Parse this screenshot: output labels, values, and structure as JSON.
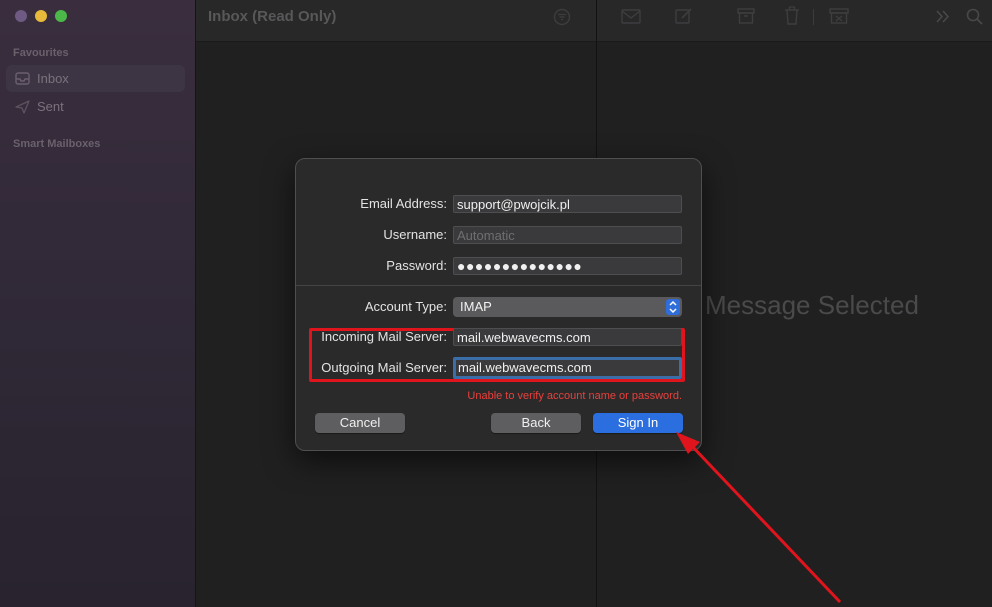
{
  "sidebar": {
    "favourites_title": "Favourites",
    "items": [
      {
        "label": "Inbox",
        "icon": "inbox-icon",
        "active": true
      },
      {
        "label": "Sent",
        "icon": "paper-plane-icon",
        "active": false
      }
    ],
    "smart_mailboxes_title": "Smart Mailboxes"
  },
  "message_list": {
    "title": "Inbox (Read Only)",
    "filter_icon": "filter-icon"
  },
  "viewer": {
    "toolbar_icons": [
      "envelope-icon",
      "compose-icon",
      "archive-icon",
      "trash-icon",
      "junk-icon",
      "chevron-double-right-icon",
      "search-icon"
    ],
    "empty_text": "Message Selected"
  },
  "dialog": {
    "email_label": "Email Address:",
    "email_value": "support@pwojcik.pl",
    "username_label": "Username:",
    "username_placeholder": "Automatic",
    "password_label": "Password:",
    "password_value": "●●●●●●●●●●●●●●",
    "account_type_label": "Account Type:",
    "account_type_value": "IMAP",
    "incoming_label": "Incoming Mail Server:",
    "incoming_value": "mail.webwavecms.com",
    "outgoing_label": "Outgoing Mail Server:",
    "outgoing_value": "mail.webwavecms.com",
    "error_message": "Unable to verify account name or password.",
    "cancel_label": "Cancel",
    "back_label": "Back",
    "sign_in_label": "Sign In"
  },
  "colors": {
    "accent_blue": "#2a6ee0",
    "highlight_red": "#e0141c",
    "error_red": "#e8403b"
  }
}
